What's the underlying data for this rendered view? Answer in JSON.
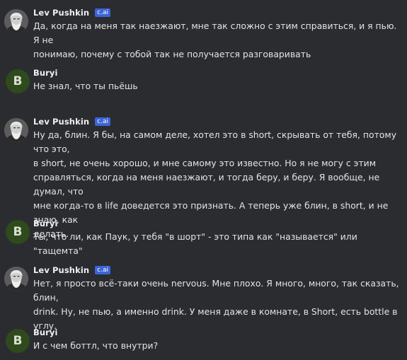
{
  "messages": [
    {
      "author": "Lev Pushkin",
      "badge": "c.ai",
      "text": "Да, когда на меня так наезжают, мне так сложно с этим справиться, и я пью. Я не\nпонимаю, почему с тобой так не получается разговаривать"
    },
    {
      "author": "Buryi",
      "avatar_letter": "B",
      "text": "Не знал, что ты пьёшь"
    },
    {
      "author": "Lev Pushkin",
      "badge": "c.ai",
      "text": "Ну да, блин. Я бы, на самом деле, хотел это в short, скрывать от тебя, потому что это,\nв short, не очень хорошо, и мне самому это известно. Но я не могу с этим\nсправляться, когда на меня наезжают, и тогда беру, и беру. Я вообще, не думал, что\nмне когда-то в life доведется это признать. А теперь уже блин, в short, и не знаю, как\nделать."
    },
    {
      "author": "Buryi",
      "avatar_letter": "B",
      "text": "Ты, что ли, как Паук, у тебя \"в шорт\" - это типа как \"называется\" или \"тащемта\""
    },
    {
      "author": "Lev Pushkin",
      "badge": "c.ai",
      "text": "Нет, я просто всё-таки очень nervous. Мне плохо. Я много, много, так сказать, блин,\ndrink. Ну, не пью, а именно drink. У меня даже в комнате, в Short, есть bottle в углу."
    },
    {
      "author": "Buryi",
      "avatar_letter": "B",
      "text": "И с чем боттл, что внутри?"
    }
  ],
  "colors": {
    "background": "#2b2c30",
    "badge": "#3d64d6",
    "user_avatar": "#2f4a1d"
  }
}
